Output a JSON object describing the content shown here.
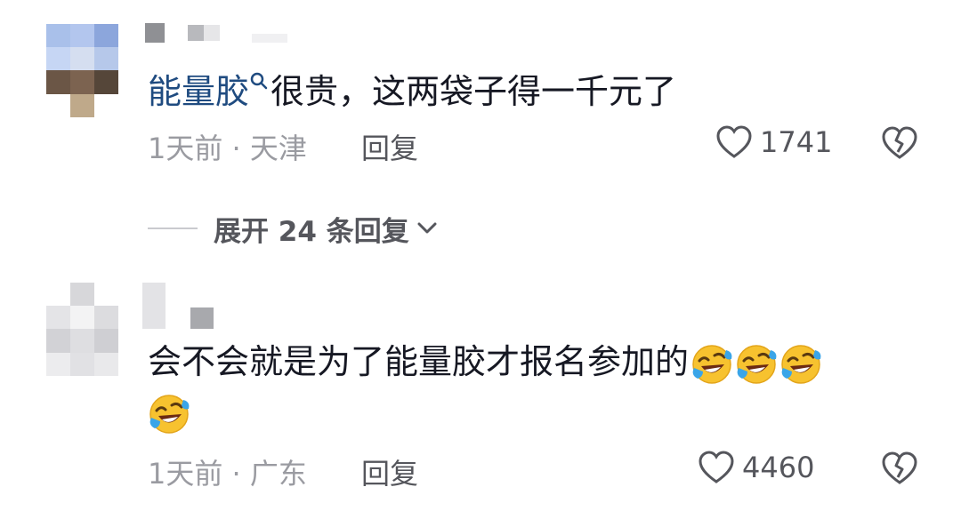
{
  "comments": [
    {
      "link_text": "能量胶",
      "text": "很贵，这两袋子得一千元了",
      "time": "1天前",
      "separator": "·",
      "location": "天津",
      "reply_label": "回复",
      "likes": "1741"
    },
    {
      "text": "会不会就是为了能量胶才报名参加的",
      "time": "1天前",
      "separator": "·",
      "location": "广东",
      "reply_label": "回复",
      "likes": "4460"
    }
  ],
  "expand_replies": "展开 24 条回复",
  "icons": {
    "like": "heart-outline-icon",
    "dislike": "broken-heart-icon",
    "search": "search-icon",
    "expand": "chevron-down-icon",
    "emoji": "rofl-emoji-icon"
  },
  "colors": {
    "link": "#1f4b80",
    "text": "#161823",
    "meta": "#9a9ba1",
    "action": "#55565c",
    "emoji_yellow": "#f7c22f",
    "emoji_tear": "#3aa5e8"
  }
}
